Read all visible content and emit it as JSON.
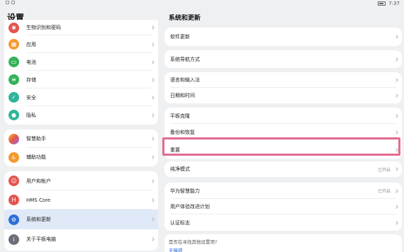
{
  "status_bar": {
    "time": "7:37"
  },
  "left_panel": {
    "title": "设置",
    "group1": [
      {
        "label": "生物识别和密码",
        "icon": "fingerprint-icon",
        "color": "#e2554f"
      },
      {
        "label": "应用",
        "icon": "apps-icon",
        "color": "#f29a2e"
      },
      {
        "label": "电池",
        "icon": "battery-icon",
        "color": "#35b25a"
      },
      {
        "label": "存储",
        "icon": "storage-icon",
        "color": "#35b25a"
      },
      {
        "label": "安全",
        "icon": "shield-icon",
        "color": "#2fb59a"
      },
      {
        "label": "隐私",
        "icon": "privacy-icon",
        "color": "#2fb59a"
      }
    ],
    "group2": [
      {
        "label": "智慧助手",
        "icon": "assistant-icon",
        "color": "#9b6cf0"
      },
      {
        "label": "辅助功能",
        "icon": "accessibility-icon",
        "color": "#f29a2e"
      }
    ],
    "group3": [
      {
        "label": "用户和帐户",
        "icon": "user-icon",
        "color": "#e2554f"
      },
      {
        "label": "HMS Core",
        "icon": "hms-core-icon",
        "color": "#e2554f"
      },
      {
        "label": "系统和更新",
        "icon": "system-gear-icon",
        "color": "#2d6fd6"
      },
      {
        "label": "关于平板电脑",
        "icon": "info-icon",
        "color": "#6b7078"
      }
    ]
  },
  "right_panel": {
    "title": "系统和更新",
    "software_update": "软件更新",
    "navigation": "系统导航方式",
    "language_input": "语言和输入法",
    "date_time": "日期和时间",
    "tablet_clone": "平板克隆",
    "backup_restore": "备份和恢复",
    "reset": "重置",
    "pure_mode": "纯净模式",
    "pure_mode_value": "已开启",
    "huawei_smart": "华为智慧能力",
    "huawei_smart_value": "已开启",
    "user_experience": "用户体验改进计划",
    "certification": "认证标志",
    "hint_title": "是否在寻找其他设置项?",
    "hint_link": "无障碍"
  },
  "colors": {
    "highlight": "#e46b8f",
    "selected_bg": "#dfe9f7",
    "link": "#2d6fd6"
  }
}
